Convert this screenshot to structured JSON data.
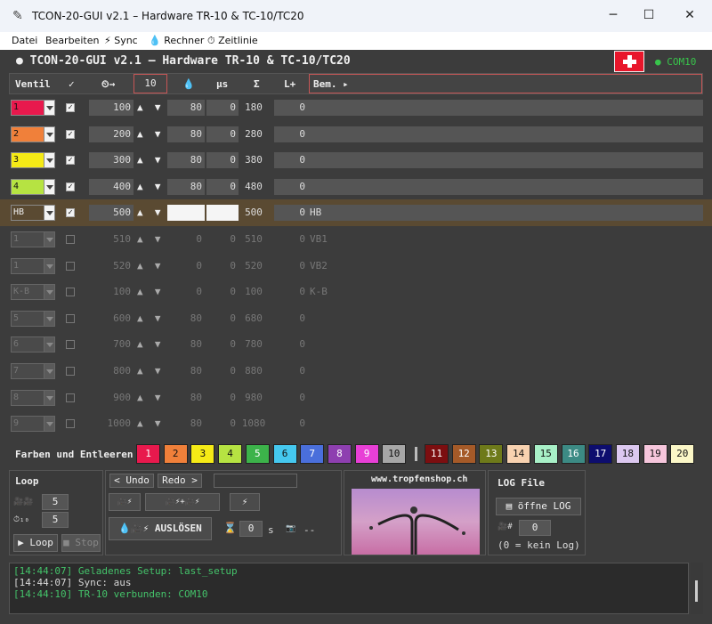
{
  "window": {
    "title": "TCON-20-GUI v2.1 – Hardware TR-10 & TC-10/TC20",
    "minimize": "─",
    "maximize": "☐",
    "close": "✕"
  },
  "menu": [
    {
      "label": "Datei"
    },
    {
      "label": "Bearbeiten"
    },
    {
      "label": "⚡ Sync"
    },
    {
      "label": "💧 Rechner"
    },
    {
      "label": "⏱ Zeitlinie"
    }
  ],
  "header": {
    "title": "● TCON-20-GUI v2.1 – Hardware TR-10 & TC-10/TC20",
    "com": "● COM10"
  },
  "columns": {
    "ventil": "Ventil",
    "check": "✓",
    "time": "⏲→",
    "step": "10",
    "drop": "💧",
    "us": "µs",
    "sigma": "Σ",
    "lplus": "L+",
    "bem": "Bem. ▸"
  },
  "rows": [
    {
      "name": "1",
      "color": "#e8194d",
      "checked": true,
      "start": "100",
      "dur": "80",
      "us": "0",
      "sum": "180",
      "lplus": "0",
      "bem": "",
      "enabled": true
    },
    {
      "name": "2",
      "color": "#f0803a",
      "checked": true,
      "start": "200",
      "dur": "80",
      "us": "0",
      "sum": "280",
      "lplus": "0",
      "bem": "",
      "enabled": true
    },
    {
      "name": "3",
      "color": "#f5ea16",
      "checked": true,
      "start": "300",
      "dur": "80",
      "us": "0",
      "sum": "380",
      "lplus": "0",
      "bem": "",
      "enabled": true
    },
    {
      "name": "4",
      "color": "#b6e342",
      "checked": true,
      "start": "400",
      "dur": "80",
      "us": "0",
      "sum": "480",
      "lplus": "0",
      "bem": "",
      "enabled": true
    },
    {
      "name": "HB",
      "color": "#5a4a32",
      "checked": true,
      "start": "500",
      "dur": "",
      "us": "",
      "sum": "500",
      "lplus": "0",
      "bem": "HB",
      "enabled": true,
      "hb": true
    },
    {
      "name": "1",
      "color": "",
      "checked": false,
      "start": "510",
      "dur": "0",
      "us": "0",
      "sum": "510",
      "lplus": "0",
      "bem": "VB1",
      "enabled": false
    },
    {
      "name": "1",
      "color": "",
      "checked": false,
      "start": "520",
      "dur": "0",
      "us": "0",
      "sum": "520",
      "lplus": "0",
      "bem": "VB2",
      "enabled": false
    },
    {
      "name": "K-B",
      "color": "",
      "checked": false,
      "start": "100",
      "dur": "0",
      "us": "0",
      "sum": "100",
      "lplus": "0",
      "bem": "K-B",
      "enabled": false
    },
    {
      "name": "5",
      "color": "",
      "checked": false,
      "start": "600",
      "dur": "80",
      "us": "0",
      "sum": "680",
      "lplus": "0",
      "bem": "",
      "enabled": false
    },
    {
      "name": "6",
      "color": "",
      "checked": false,
      "start": "700",
      "dur": "80",
      "us": "0",
      "sum": "780",
      "lplus": "0",
      "bem": "",
      "enabled": false
    },
    {
      "name": "7",
      "color": "",
      "checked": false,
      "start": "800",
      "dur": "80",
      "us": "0",
      "sum": "880",
      "lplus": "0",
      "bem": "",
      "enabled": false
    },
    {
      "name": "8",
      "color": "",
      "checked": false,
      "start": "900",
      "dur": "80",
      "us": "0",
      "sum": "980",
      "lplus": "0",
      "bem": "",
      "enabled": false
    },
    {
      "name": "9",
      "color": "",
      "checked": false,
      "start": "1000",
      "dur": "80",
      "us": "0",
      "sum": "1080",
      "lplus": "0",
      "bem": "",
      "enabled": false
    }
  ],
  "colorbar": {
    "label": "Farben und Entleeren",
    "buttons": [
      {
        "n": "1",
        "bg": "#e8194d"
      },
      {
        "n": "2",
        "bg": "#f0803a"
      },
      {
        "n": "3",
        "bg": "#f5ea16"
      },
      {
        "n": "4",
        "bg": "#b6e342"
      },
      {
        "n": "5",
        "bg": "#3cb34a"
      },
      {
        "n": "6",
        "bg": "#45c8ef"
      },
      {
        "n": "7",
        "bg": "#4a6fdb"
      },
      {
        "n": "8",
        "bg": "#8e3fb0"
      },
      {
        "n": "9",
        "bg": "#e83fd6"
      },
      {
        "n": "10",
        "bg": "#a7a7a7"
      },
      {
        "n": "11",
        "bg": "#7c0e10"
      },
      {
        "n": "12",
        "bg": "#a55a28"
      },
      {
        "n": "13",
        "bg": "#6e7a1a"
      },
      {
        "n": "14",
        "bg": "#f8d2b0"
      },
      {
        "n": "15",
        "bg": "#a8f0c7"
      },
      {
        "n": "16",
        "bg": "#3c8a84"
      },
      {
        "n": "17",
        "bg": "#0d0d6e"
      },
      {
        "n": "18",
        "bg": "#dcc8f0"
      },
      {
        "n": "19",
        "bg": "#f6c6dc"
      },
      {
        "n": "20",
        "bg": "#fbf7c7"
      }
    ]
  },
  "loop": {
    "title": "Loop",
    "count": "5",
    "delay": "5",
    "count_icon": "🎥🎥",
    "delay_icon": "⏱₁₀",
    "loop_label": "▶ Loop",
    "stop_label": "■ Stop"
  },
  "controls": {
    "undo": "< Undo",
    "redo": "Redo >",
    "btn1": "🎥⚡",
    "btn2": "🎥⚡+🎥⚡",
    "btn3": "⚡",
    "fire": "💧🎥⚡  AUSLÖSEN",
    "timer_icon": "⌛",
    "seconds": "0",
    "seconds_unit": "s",
    "cam_icon": "📷",
    "cam_value": "--"
  },
  "web": {
    "url": "www.tropfenshop.ch"
  },
  "logfile": {
    "title": "LOG File",
    "open": "▤ öffne LOG",
    "num_icon": "🎥#",
    "num": "0",
    "hint": "(0 = kein Log)"
  },
  "log": [
    {
      "text": "[14:44:07] Geladenes Setup: last_setup",
      "color": "green"
    },
    {
      "text": "[14:44:07] Sync: aus",
      "color": "gray"
    },
    {
      "text": "[14:44:10] TR-10 verbunden: COM10",
      "color": "green"
    }
  ]
}
